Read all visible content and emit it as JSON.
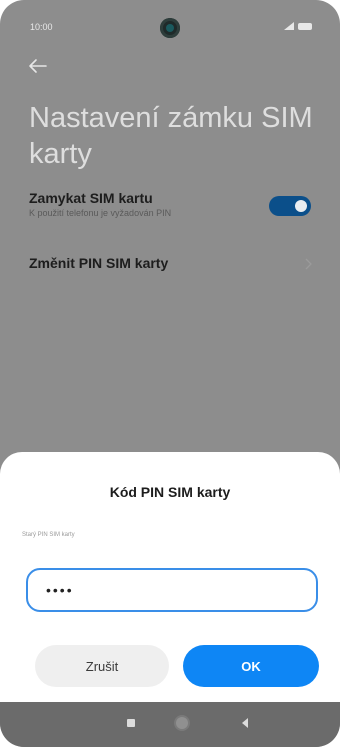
{
  "status_bar": {
    "time": "10:00"
  },
  "page": {
    "title": "Nastavení zámku SIM karty"
  },
  "settings": {
    "lock_sim": {
      "title": "Zamykat SIM kartu",
      "subtitle": "K použití telefonu je vyžadován PIN",
      "enabled": true
    },
    "change_pin": {
      "title": "Změnit PIN SIM karty"
    }
  },
  "dialog": {
    "title": "Kód PIN SIM karty",
    "label": "Starý PIN SIM karty",
    "pin_value": "••••",
    "cancel_label": "Zrušit",
    "ok_label": "OK"
  },
  "colors": {
    "accent": "#0e86f5",
    "toggle_on": "#0b4f8a",
    "input_border": "#3a8ee8"
  },
  "icons": [
    "back-arrow-icon",
    "chevron-right-icon",
    "signal-icon",
    "battery-icon",
    "nav-recent-icon",
    "nav-home-icon",
    "nav-back-icon"
  ]
}
